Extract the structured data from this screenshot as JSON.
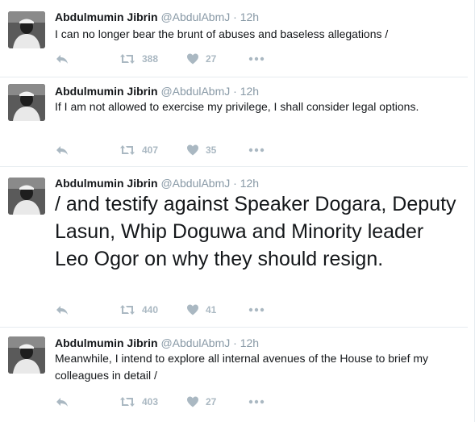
{
  "tweets": [
    {
      "name": "Abdulmumin Jibrin",
      "handle": "@AbdulAbmJ",
      "separator": "·",
      "time": "12h",
      "text": "I can no longer bear the brunt of abuses and baseless allegations /",
      "retweets": "388",
      "likes": "27"
    },
    {
      "name": "Abdulmumin Jibrin",
      "handle": "@AbdulAbmJ",
      "separator": "·",
      "time": "12h",
      "text": "If I am not allowed to exercise my privilege, I shall consider legal options.",
      "retweets": "407",
      "likes": "35"
    },
    {
      "name": "Abdulmumin Jibrin",
      "handle": "@AbdulAbmJ",
      "separator": "·",
      "time": "12h",
      "text": "/ and testify against Speaker Dogara, Deputy Lasun, Whip Doguwa and Minority leader Leo Ogor on why they should resign.",
      "retweets": "440",
      "likes": "41"
    },
    {
      "name": "Abdulmumin Jibrin",
      "handle": "@AbdulAbmJ",
      "separator": "·",
      "time": "12h",
      "text": "Meanwhile, I intend to explore all internal avenues of the House to brief my colleagues in detail /",
      "retweets": "403",
      "likes": "27"
    }
  ],
  "icons": {
    "reply": "reply-icon",
    "retweet": "retweet-icon",
    "like": "heart-icon",
    "more": "more-icon"
  },
  "colors": {
    "icon": "#aab8c2",
    "meta": "#8899a6",
    "text": "#14171a",
    "divider": "#e6ecf0"
  }
}
